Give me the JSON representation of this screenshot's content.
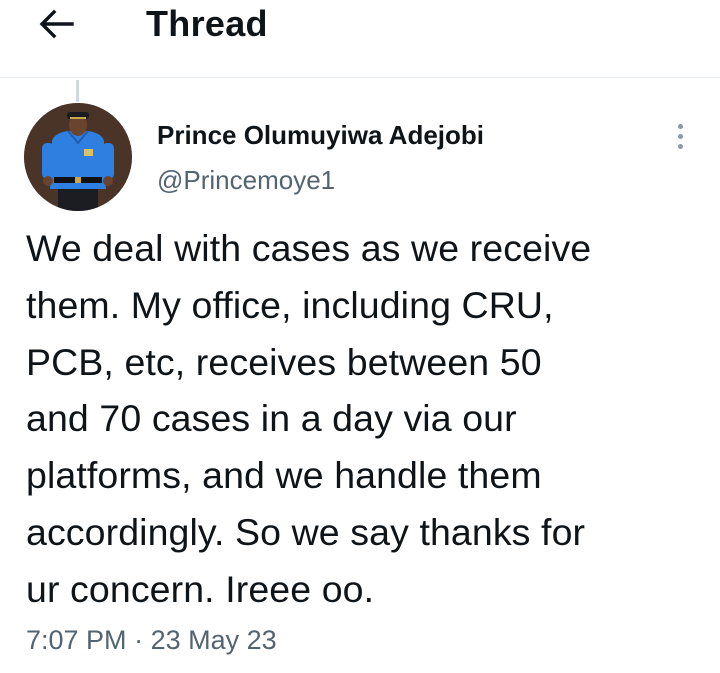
{
  "header": {
    "title": "Thread",
    "back_icon": "arrow-left-icon"
  },
  "tweet": {
    "author": {
      "display_name": "Prince Olumuyiwa Adejobi",
      "handle": "@Princemoye1"
    },
    "text": "We deal with cases as we receive\nthem. My office, including CRU,\nPCB, etc, receives between 50\nand 70 cases in a day via our\nplatforms, and we handle them\naccordingly. So we say thanks for\nur concern. Ireee oo.",
    "time": "7:07 PM",
    "separator": "·",
    "date": "23 May 23"
  },
  "colors": {
    "text_primary": "#0f1419",
    "text_secondary": "#536471",
    "divider": "#e6ecf0"
  }
}
